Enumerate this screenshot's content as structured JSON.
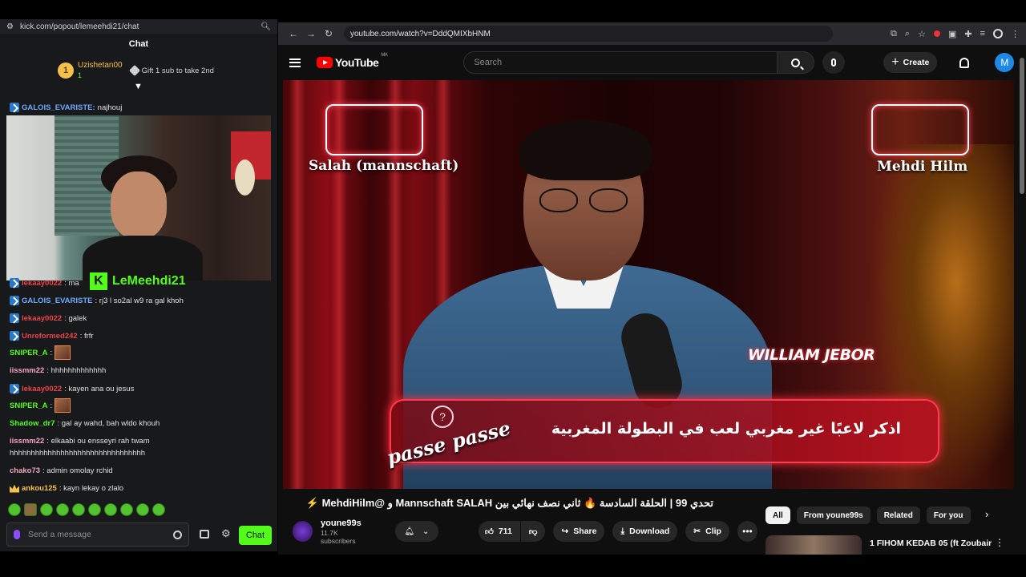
{
  "kick": {
    "url": "kick.com/popout/lemeehdi21/chat",
    "title": "Chat",
    "pinned": {
      "rank": "1",
      "user": "Uzishetan00",
      "count": "1",
      "gift_text": "Gift 1 sub to take 2nd"
    },
    "partial_top": {
      "user": "GALOIS_EVARISTE:",
      "text": "najhouj"
    },
    "streamer_name": "LeMeehdi21",
    "messages": [
      {
        "user": "lekaay0022",
        "text": ": ma"
      },
      {
        "user": "GALOIS_EVARISTE",
        "text": ": rj3 l so2al w9 ra gal khoh"
      },
      {
        "user": "lekaay0022",
        "text": ": galek"
      },
      {
        "user": "Unreformed242",
        "text": ": frfr"
      },
      {
        "user": "SNIPER_A",
        "text": ":"
      },
      {
        "user": "iissmm22",
        "text": ": hhhhhhhhhhhhh"
      },
      {
        "user": "lekaay0022",
        "text": ": kayen ana ou jesus"
      },
      {
        "user": "SNIPER_A",
        "text": ":"
      },
      {
        "user": "Shadow_dr7",
        "text": ": gal ay wahd, bah wldo khouh"
      },
      {
        "user": "iissmm22",
        "text": ": elkaabi ou ensseyri rah twam"
      },
      {
        "user": "",
        "text": "hhhhhhhhhhhhhhhhhhhhhhhhhhhhhhhh"
      },
      {
        "user": "chako73",
        "text": ": admin omolay rchid"
      },
      {
        "user": "ankou125",
        "text": ": kayn lekay o zlalo"
      }
    ],
    "input_placeholder": "Send a message",
    "chat_button": "Chat",
    "colors": {
      "accent": "#53fc18",
      "bg": "#18191b"
    }
  },
  "browser": {
    "url": "youtube.com/watch?v=DddQMIXbHNM"
  },
  "youtube": {
    "logo": "YouTube",
    "country": "MA",
    "search_placeholder": "Search",
    "create": "Create",
    "avatar_letter": "M",
    "video": {
      "label_left": "Salah (mannschaft)",
      "label_right": "Mehdi Hilm",
      "sponsor": "WILLIAM JEBOR",
      "question": "اذكر لاعبًا غير مغربي لعب في البطولة المغربية",
      "passe": "passe passe"
    },
    "title": "تحدي 99 | الحلقة السادسة 🔥 ثاني نصف نهائي بين Mannschaft SALAH و @MehdiHilm ⚡",
    "channel": {
      "name": "youne99s",
      "subs": "11.7K subscribers"
    },
    "likes": "711",
    "actions": {
      "share": "Share",
      "download": "Download",
      "clip": "Clip"
    },
    "chips": [
      "All",
      "From youne99s",
      "Related",
      "For you"
    ],
    "rec_title": "1 FIHOM KEDAB 05 (ft Zoubair",
    "colors": {
      "brand": "#ff0000",
      "bg": "#0f0f0f"
    }
  }
}
